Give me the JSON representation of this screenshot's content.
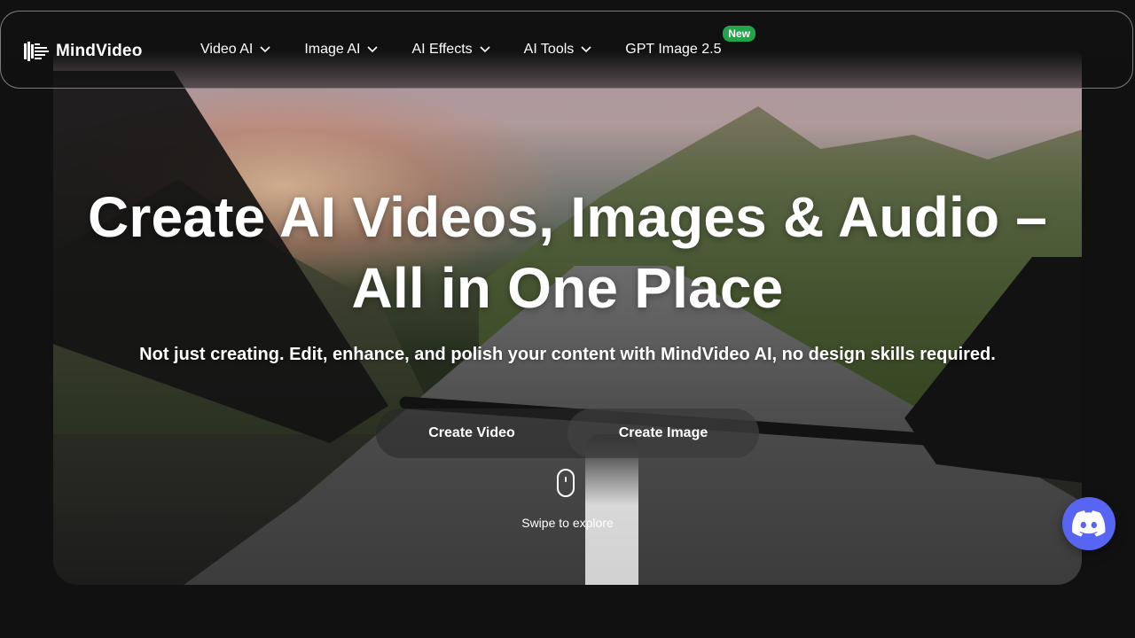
{
  "brand": {
    "name": "MindVideo"
  },
  "nav": {
    "items": [
      {
        "label": "Video AI"
      },
      {
        "label": "Image AI"
      },
      {
        "label": "AI Effects"
      },
      {
        "label": "AI Tools"
      }
    ],
    "gpt_item": {
      "label": "GPT Image 2.5",
      "badge": "New"
    }
  },
  "hero": {
    "headline_line1": "Create AI Videos, Images & Audio –",
    "headline_line2": "All in One Place",
    "subtitle": "Not just creating. Edit, enhance, and polish your content with MindVideo AI, no design skills required.",
    "cta_primary": "Create Video",
    "cta_secondary": "Create Image",
    "swipe_text": "Swipe to explore"
  },
  "colors": {
    "background": "#111111",
    "badge_green": "#22a54a",
    "discord_blue": "#5865f2"
  }
}
